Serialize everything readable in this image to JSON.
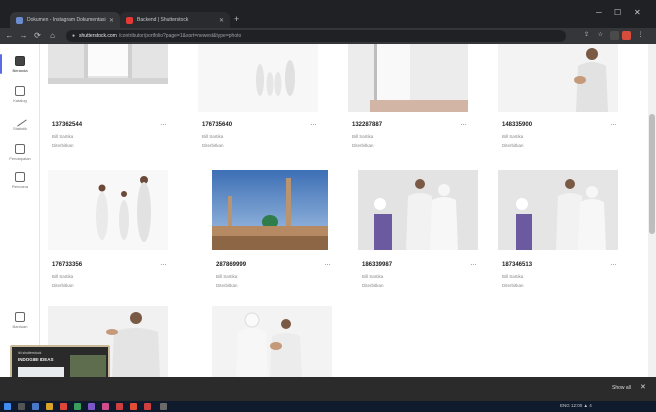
{
  "browser": {
    "tabs": [
      {
        "label": "Dokumen - Instagram Dokumentasi"
      },
      {
        "label": "Backend | Shutterstock"
      }
    ],
    "new_tab_label": "+",
    "url_domain": "shutterstock.com",
    "url_path": "/contributor/portfolio?page=1&sort=newest&type=photo"
  },
  "sidebar": {
    "items": [
      {
        "label": "Beranda"
      },
      {
        "label": "Katalog"
      },
      {
        "label": "Statistik"
      },
      {
        "label": "Pendapatan"
      },
      {
        "label": "Rencana"
      }
    ],
    "bottom_item": {
      "label": "Bantuan"
    }
  },
  "cards": [
    {
      "id": "137362544",
      "line1": "Bill Sartika",
      "line2": "Diterbitkan"
    },
    {
      "id": "176735640",
      "line1": "Bill Sartika",
      "line2": "Diterbitkan"
    },
    {
      "id": "132287887",
      "line1": "Bill Sartika",
      "line2": "Diterbitkan"
    },
    {
      "id": "148335900",
      "line1": "Bill Sartika",
      "line2": "Diterbitkan"
    },
    {
      "id": "176733356",
      "line1": "Bill Sartika",
      "line2": "Diterbitkan"
    },
    {
      "id": "287869999",
      "line1": "Bill Sartika",
      "line2": "Diterbitkan"
    },
    {
      "id": "186339987",
      "line1": "Bill Sartika",
      "line2": "Diterbitkan"
    },
    {
      "id": "187346513",
      "line1": "Bill Sartika",
      "line2": "Diterbitkan"
    },
    {
      "id": "",
      "line1": "",
      "line2": ""
    },
    {
      "id": "",
      "line1": "",
      "line2": ""
    }
  ],
  "card_menu_label": "…",
  "preview": {
    "title1": "ibl shutterstock",
    "title2": "INDOGIBI IDEAS"
  },
  "downloads_bar": {
    "show_all": "Show all",
    "close": "✕"
  },
  "taskbar": {
    "tray_text": "ENG  12:00  ▲  4"
  }
}
